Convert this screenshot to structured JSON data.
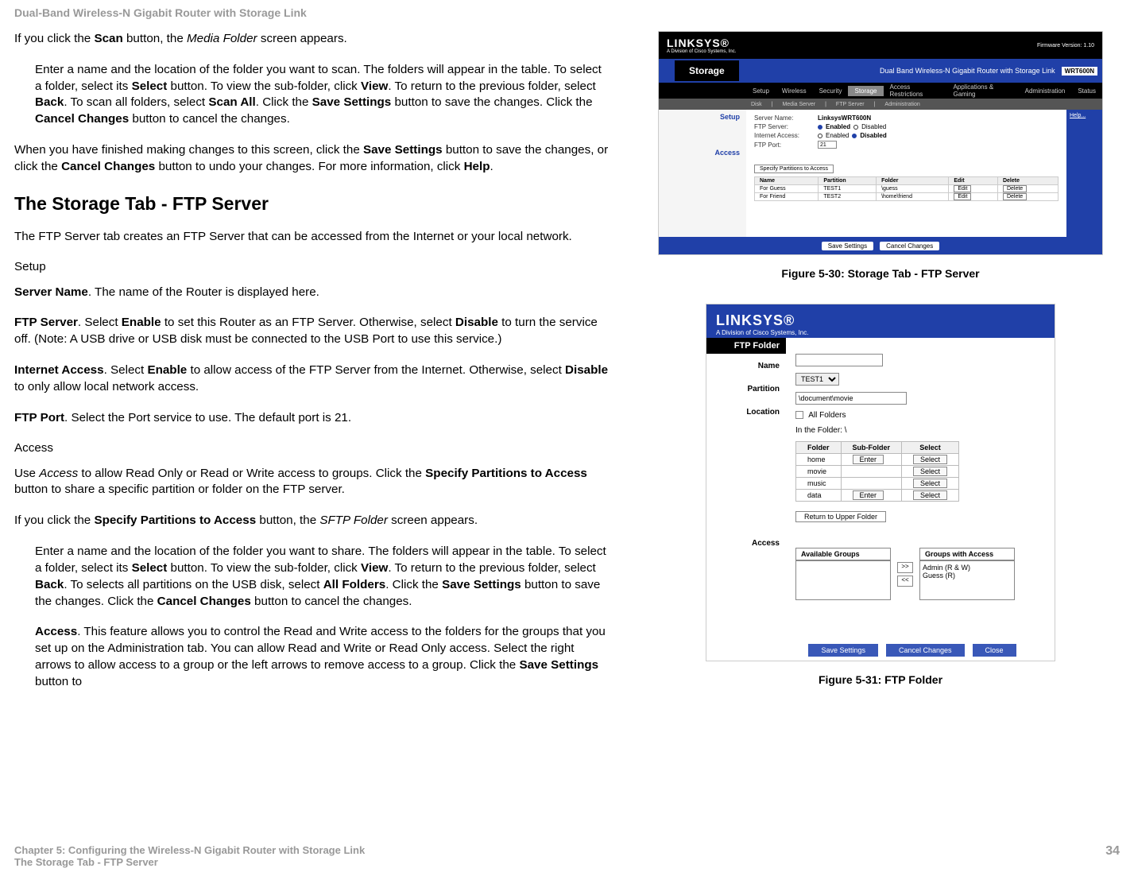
{
  "header": "Dual-Band Wireless-N Gigabit Router with Storage Link",
  "p1_a": "If you click the ",
  "p1_b": "Scan",
  "p1_c": " button, the ",
  "p1_d": "Media Folder",
  "p1_e": " screen appears.",
  "p2_a": "Enter a name and the location of the folder you want to scan. The folders will appear in the table. To select a folder, select its ",
  "select": "Select",
  "p2_b": " button. To view the sub-folder, click ",
  "view": "View",
  "p2_c": ". To return to the previous folder, select ",
  "back": "Back",
  "p2_d": ". To scan all folders, select ",
  "scanall": "Scan All",
  "p2_e": ". Click the ",
  "savesettings": "Save Settings",
  "p2_f": " button to save the changes. Click the ",
  "cancelchanges": "Cancel Changes",
  "p2_g": " button to cancel the changes.",
  "p3_a": "When you have finished making changes to this screen, click the ",
  "p3_b": " button to save the changes, or click the ",
  "p3_c": " button to undo your changes. For more information, click ",
  "help": "Help",
  "period": ".",
  "h2": "The Storage Tab - FTP Server",
  "p4": "The FTP Server tab creates an FTP Server that can be accessed from the Internet or your local network.",
  "setup": "Setup",
  "servername": "Server Name",
  "p5_b": ". The name of the Router is displayed here.",
  "ftpserver": "FTP Server",
  "p6_a": ". Select ",
  "enable": "Enable",
  "p6_b": " to set this Router as an FTP Server. Otherwise, select ",
  "disable": "Disable",
  "p6_c": " to turn the service off. (Note: A USB drive or USB disk must be connected to the USB Port to use this service.)",
  "internetaccess": "Internet Access",
  "p7_b": " to allow access of the FTP Server from the Internet. Otherwise, select ",
  "p7_c": " to only allow local network access.",
  "ftpport": "FTP Port",
  "p8_b": ". Select the Port service to use. The default port is 21.",
  "access": "Access",
  "p9_a": "Use ",
  "p9_b": " to allow Read Only or Read or Write access to groups. Click the ",
  "specifypartitions": "Specify Partitions to Access",
  "p9_c": " button to share a specific partition or folder on the FTP server.",
  "p10_a": "If you click the ",
  "p10_b": " button, the ",
  "sftpfolder": "SFTP Folder",
  "p10_c": " screen appears.",
  "p11_a": "Enter a name and the location of the folder you want to share. The folders will appear in the table. To select a folder, select its ",
  "p11_b": ". To selects all partitions on the USB disk, select ",
  "allfolders": "All Folders",
  "accessbold": "Access",
  "p12_a": ". This feature allows you to control the Read and Write access to the folders for the groups that you set up on the Administration tab. You can allow Read and Write or Read Only access. Select the right arrows to allow access to a group or the left arrows to remove access to a group. Click the ",
  "p12_b": " button to",
  "fig1_caption": "Figure 5-30: Storage Tab - FTP Server",
  "fig2_caption": "Figure 5-31: FTP Folder",
  "footer_left1": "Chapter 5: Configuring the Wireless-N Gigabit Router with Storage Link",
  "footer_left2": "The Storage Tab - FTP Server",
  "page_num": "34",
  "shot1": {
    "logo": "LINKSYS®",
    "logosub": "A Division of Cisco Systems, Inc.",
    "fw": "Firmware Version: 1.10",
    "title": "Dual Band Wireless-N Gigabit Router with Storage Link",
    "model": "WRT600N",
    "tab_storage": "Storage",
    "tabs": [
      "Setup",
      "Wireless",
      "Security",
      "Storage",
      "Access Restrictions",
      "Applications & Gaming",
      "Administration",
      "Status"
    ],
    "subtabs": [
      "Disk",
      "Media Server",
      "FTP Server",
      "Administration"
    ],
    "sb_setup": "Setup",
    "sb_access": "Access",
    "help_link": "Help...",
    "server_name_lbl": "Server Name:",
    "server_name_val": "LinksysWRT600N",
    "ftp_server_lbl": "FTP Server:",
    "enabled": "Enabled",
    "disabled": "Disabled",
    "internet_access_lbl": "Internet Access:",
    "ftp_port_lbl": "FTP Port:",
    "ftp_port_val": "21",
    "specify_btn": "Specify Partitions to Access",
    "table_headers": [
      "Name",
      "Partition",
      "Folder",
      "Edit",
      "Delete"
    ],
    "rows": [
      {
        "name": "For Guess",
        "partition": "TEST1",
        "folder": "\\guess",
        "edit": "Edit",
        "delete": "Delete"
      },
      {
        "name": "For Friend",
        "partition": "TEST2",
        "folder": "\\home\\friend",
        "edit": "Edit",
        "delete": "Delete"
      }
    ],
    "save_btn": "Save Settings",
    "cancel_btn": "Cancel Changes"
  },
  "shot2": {
    "logo": "LINKSYS®",
    "logosub": "A Division of Cisco Systems, Inc.",
    "ftpfolder": "FTP Folder",
    "name_lbl": "Name",
    "partition_lbl": "Partition",
    "partition_val": "TEST1",
    "location_lbl": "Location",
    "location_val": "\\document\\movie",
    "allfolders": "All Folders",
    "inthefolder": "In the Folder: \\",
    "table_headers": [
      "Folder",
      "Sub-Folder",
      "Select"
    ],
    "rows": [
      {
        "folder": "home",
        "sub": "Enter",
        "select": "Select"
      },
      {
        "folder": "movie",
        "sub": "",
        "select": "Select"
      },
      {
        "folder": "music",
        "sub": "",
        "select": "Select"
      },
      {
        "folder": "data",
        "sub": "Enter",
        "select": "Select"
      }
    ],
    "return_btn": "Return to Upper Folder",
    "access_lbl": "Access",
    "available_groups": "Available Groups",
    "groups_with_access": "Groups with Access",
    "group1": "Admin (R & W)",
    "group2": "Guess (R)",
    "save_btn": "Save Settings",
    "cancel_btn": "Cancel Changes",
    "close_btn": "Close"
  }
}
